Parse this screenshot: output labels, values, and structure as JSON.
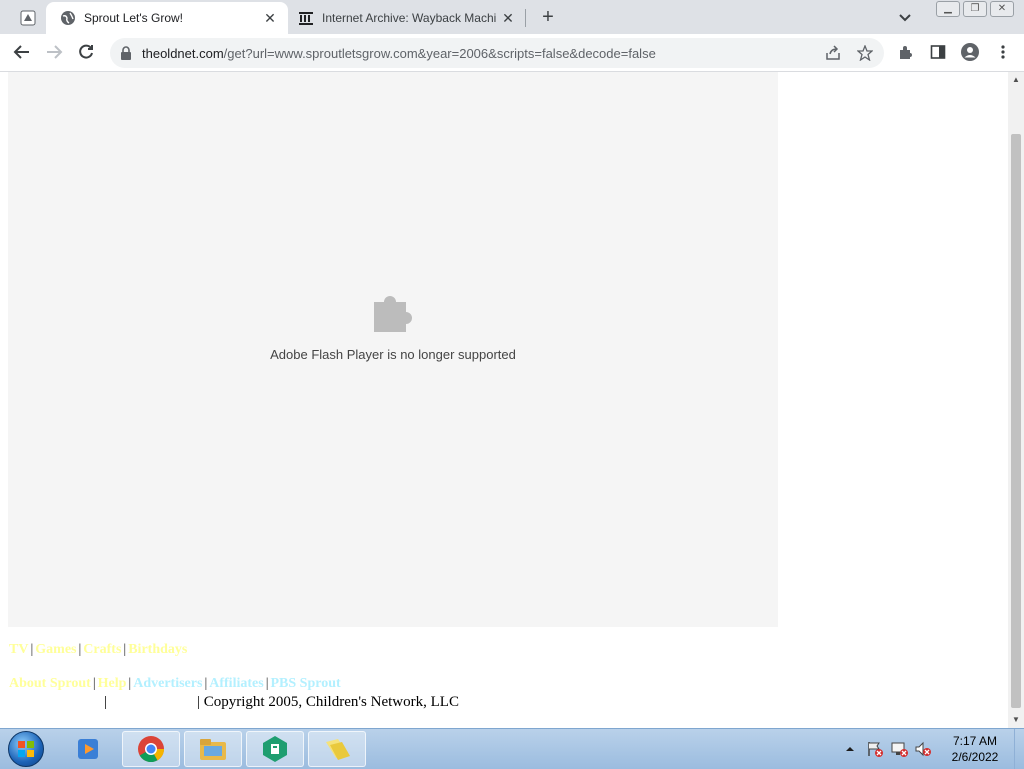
{
  "browser": {
    "tabs": [
      {
        "title": "Sprout Let's Grow!",
        "active": true,
        "favicon": "globe-icon"
      },
      {
        "title": "Internet Archive: Wayback Machi",
        "active": false,
        "favicon": "archive-icon"
      }
    ],
    "url": {
      "host": "theoldnet.com",
      "path": "/get?url=www.sproutletsgrow.com&year=2006&scripts=false&decode=false"
    }
  },
  "page": {
    "flash_message": "Adobe Flash Player is no longer supported",
    "nav_row1": [
      {
        "label": "TV",
        "color": "#ffff99"
      },
      {
        "label": "Games",
        "color": "#ffff99"
      },
      {
        "label": "Crafts",
        "color": "#ffff99"
      },
      {
        "label": "Birthdays",
        "color": "#ffff99"
      }
    ],
    "nav_row2": [
      {
        "label": "About Sprout",
        "color": "#ffff99"
      },
      {
        "label": "Help",
        "color": "#ffff99"
      },
      {
        "label": "Advertisers",
        "color": "#b3f0ff"
      },
      {
        "label": "Affiliates",
        "color": "#b3f0ff"
      },
      {
        "label": "PBS Sprout",
        "color": "#b3f0ff"
      }
    ],
    "copyright": "| Copyright 2005, Children's Network, LLC",
    "separator": "|"
  },
  "taskbar": {
    "apps": [
      "media-player-icon",
      "chrome-icon",
      "file-explorer-icon",
      "green-app-icon",
      "folder-app-icon"
    ],
    "clock_time": "7:17 AM",
    "clock_date": "2/6/2022"
  }
}
